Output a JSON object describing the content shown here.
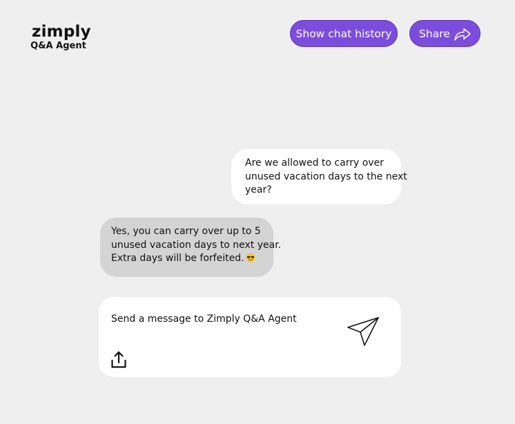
{
  "brand": {
    "name": "zimply",
    "subtitle": "Q&A Agent"
  },
  "header": {
    "history_label": "Show chat history",
    "share_label": "Share",
    "accent_color": "#7c4ddc"
  },
  "messages": [
    {
      "role": "user",
      "lines": [
        "Are we allowed to carry over",
        "unused vacation days to the next",
        "year?"
      ]
    },
    {
      "role": "agent",
      "lines": [
        "Yes, you can carry over up to 5",
        "unused vacation days to next year.",
        "Extra days will be forfeited."
      ],
      "emoji": "sunglasses-face"
    }
  ],
  "composer": {
    "placeholder": "Send a message to Zimply Q&A Agent",
    "send_icon": "paper-plane-icon",
    "upload_icon": "upload-icon"
  }
}
